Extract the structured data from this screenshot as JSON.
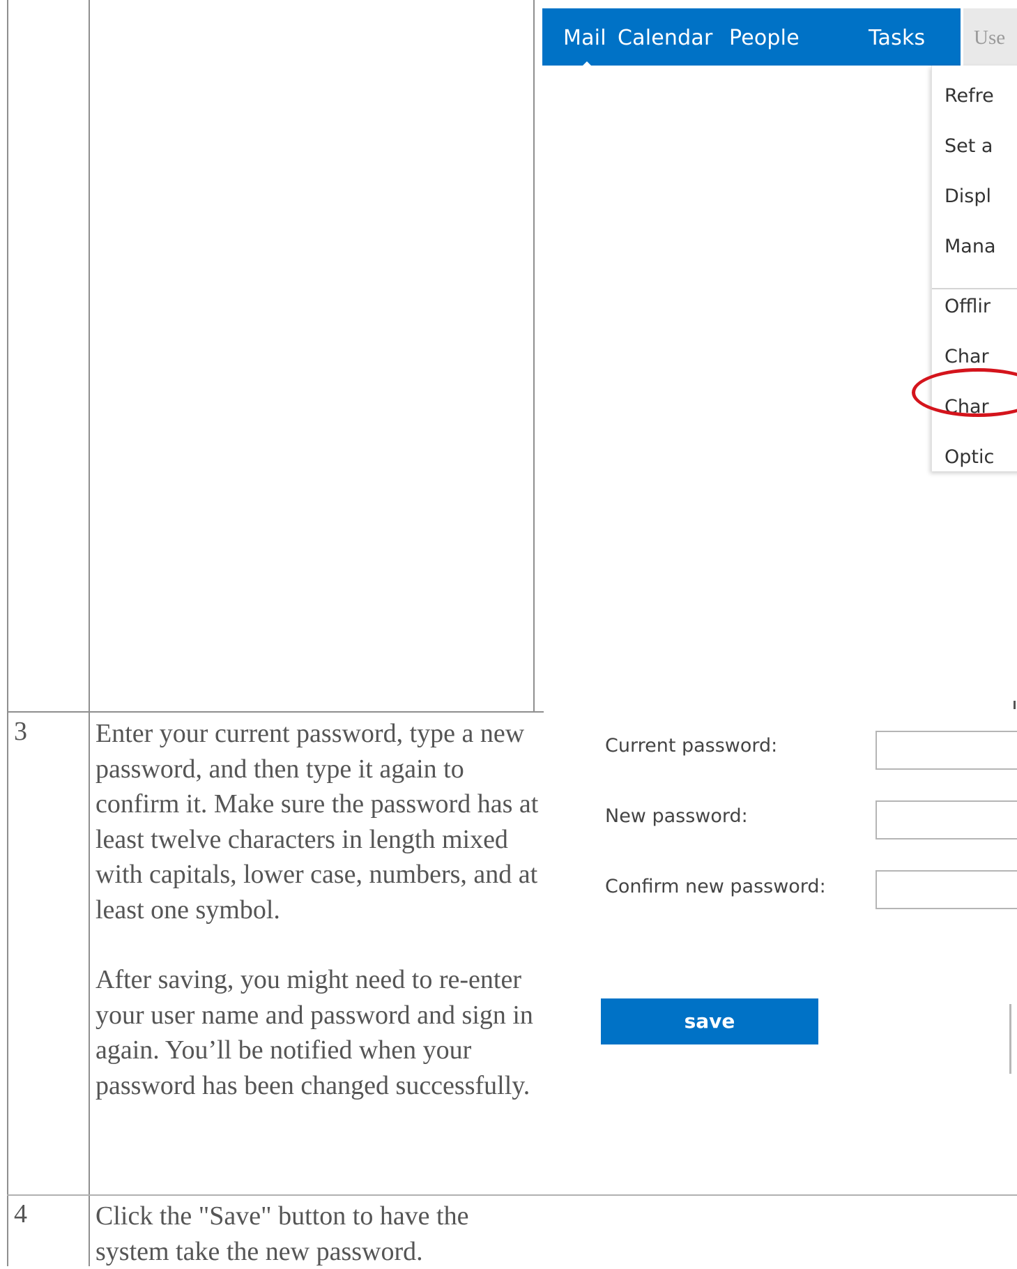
{
  "rows": [
    {
      "number": "3",
      "text_p1": "Enter your current password, type a new password, and then type it again to confirm it. Make sure the password has at least twelve characters in length mixed with capitals, lower case, numbers, and at least one symbol.",
      "text_p2": "After saving, you might need to re-enter your user name and password and sign in again. You’ll be notified when your password has been changed successfully."
    },
    {
      "number": "4",
      "text": "Click the \"Save\" button to have the system take the new password."
    }
  ],
  "nav": {
    "items": [
      "Mail",
      "Calendar",
      "People",
      "Tasks"
    ],
    "user_tab": "Use",
    "bar_color": "#0072c6"
  },
  "menu": {
    "items": [
      "Refre",
      "Set a",
      "Displ",
      "Mana",
      "Offlir",
      "Char",
      "Char",
      "Optic"
    ],
    "highlight_color": "#d4141c"
  },
  "form": {
    "current_password_label": "Current password:",
    "new_password_label": "New password:",
    "confirm_password_label": "Confirm new password:",
    "save_label": "save"
  }
}
